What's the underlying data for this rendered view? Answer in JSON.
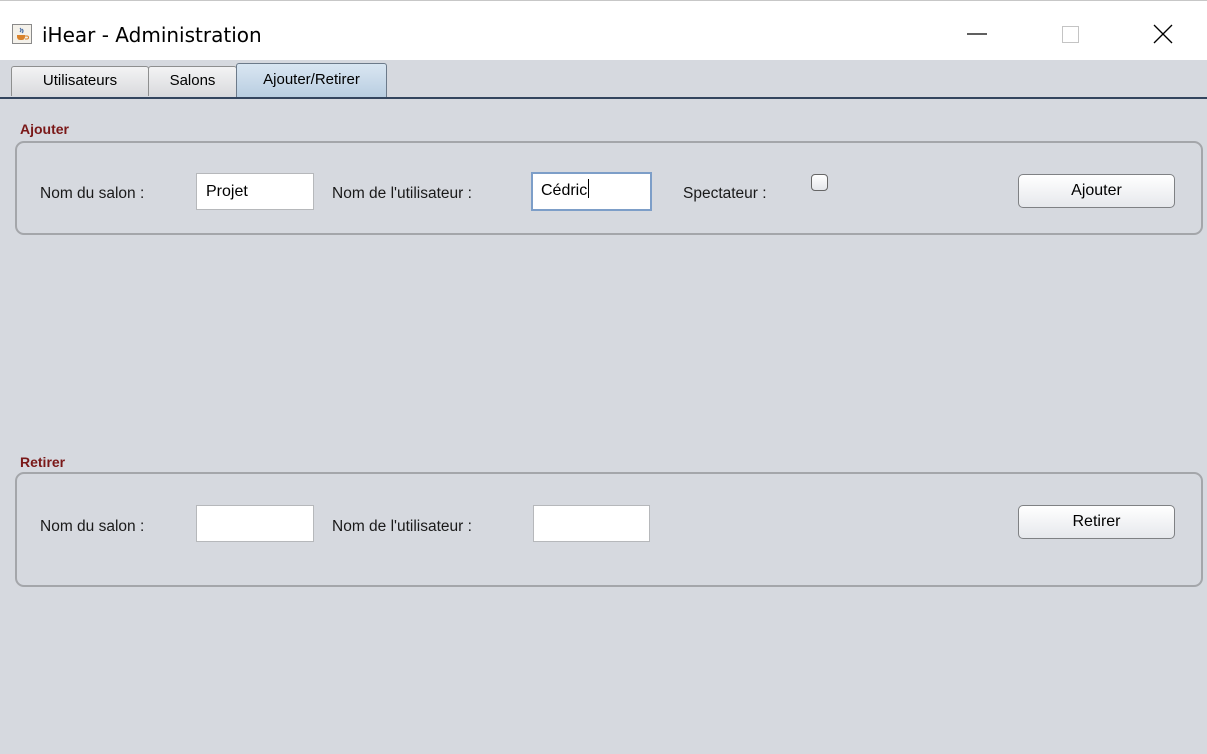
{
  "window": {
    "title": "iHear - Administration",
    "icon": "java-cup-icon",
    "controls": [
      "minimize-icon",
      "maximize-icon",
      "close-icon"
    ]
  },
  "tabs": [
    {
      "label": "Utilisateurs",
      "active": false
    },
    {
      "label": "Salons",
      "active": false
    },
    {
      "label": "Ajouter/Retirer",
      "active": true
    }
  ],
  "ajouter": {
    "section_title": "Ajouter",
    "salon_label": "Nom du salon :",
    "salon_value": "Projet",
    "user_label": "Nom de l'utilisateur :",
    "user_value": "Cédric",
    "spectator_label": "Spectateur :",
    "spectator_checked": false,
    "button_label": "Ajouter"
  },
  "retirer": {
    "section_title": "Retirer",
    "salon_label": "Nom du salon :",
    "salon_value": "",
    "user_label": "Nom de l'utilisateur :",
    "user_value": "",
    "button_label": "Retirer"
  },
  "colors": {
    "section_title": "#7a1818",
    "background": "#d6d9df",
    "focus_border": "#7d9ec8",
    "tab_underline": "#33455e"
  }
}
